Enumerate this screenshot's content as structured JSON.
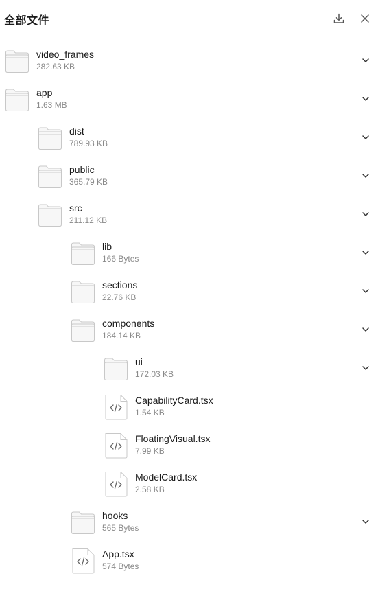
{
  "header": {
    "title": "全部文件",
    "download_icon": "download-icon",
    "close_icon": "close-icon"
  },
  "colors": {
    "folder_fill": "#f7f7f7",
    "folder_stroke": "#c8c8c8",
    "file_stroke": "#c8c8c8",
    "text": "#1a1a1a",
    "muted": "#8a8a8a"
  },
  "items": [
    {
      "name": "video_frames",
      "size": "282.63 KB",
      "type": "folder",
      "depth": 0,
      "expandable": true
    },
    {
      "name": "app",
      "size": "1.63 MB",
      "type": "folder",
      "depth": 0,
      "expandable": true
    },
    {
      "name": "dist",
      "size": "789.93 KB",
      "type": "folder",
      "depth": 1,
      "expandable": true
    },
    {
      "name": "public",
      "size": "365.79 KB",
      "type": "folder",
      "depth": 1,
      "expandable": true
    },
    {
      "name": "src",
      "size": "211.12 KB",
      "type": "folder",
      "depth": 1,
      "expandable": true
    },
    {
      "name": "lib",
      "size": "166 Bytes",
      "type": "folder",
      "depth": 2,
      "expandable": true
    },
    {
      "name": "sections",
      "size": "22.76 KB",
      "type": "folder",
      "depth": 2,
      "expandable": true
    },
    {
      "name": "components",
      "size": "184.14 KB",
      "type": "folder",
      "depth": 2,
      "expandable": true
    },
    {
      "name": "ui",
      "size": "172.03 KB",
      "type": "folder",
      "depth": 3,
      "expandable": true
    },
    {
      "name": "CapabilityCard.tsx",
      "size": "1.54 KB",
      "type": "file",
      "depth": 3,
      "expandable": false
    },
    {
      "name": "FloatingVisual.tsx",
      "size": "7.99 KB",
      "type": "file",
      "depth": 3,
      "expandable": false
    },
    {
      "name": "ModelCard.tsx",
      "size": "2.58 KB",
      "type": "file",
      "depth": 3,
      "expandable": false
    },
    {
      "name": "hooks",
      "size": "565 Bytes",
      "type": "folder",
      "depth": 2,
      "expandable": true
    },
    {
      "name": "App.tsx",
      "size": "574 Bytes",
      "type": "file",
      "depth": 2,
      "expandable": false
    }
  ]
}
